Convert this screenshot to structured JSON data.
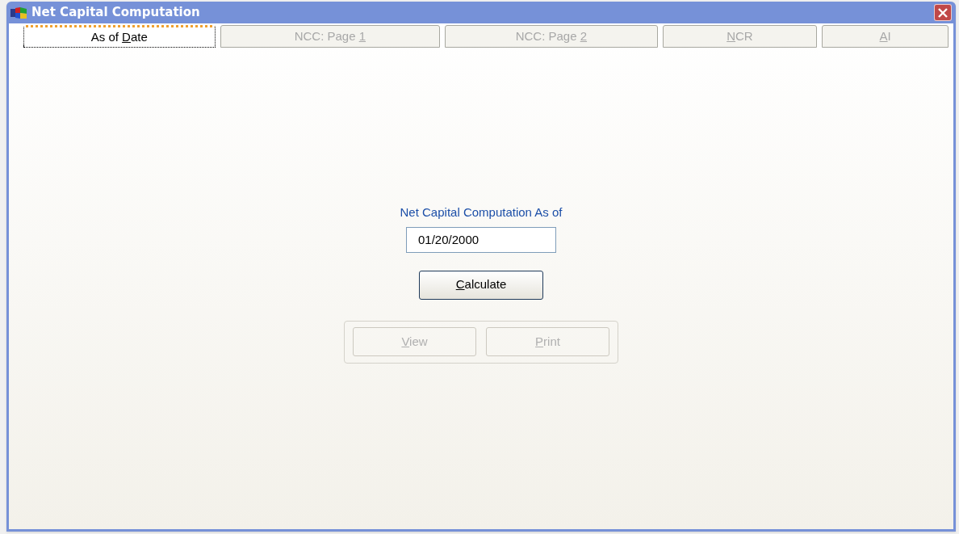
{
  "window": {
    "title": "Net Capital Computation"
  },
  "tabs": [
    {
      "before": "As of ",
      "mnemonic": "D",
      "after": "ate",
      "selected": true,
      "disabled": false
    },
    {
      "before": "NCC: Page ",
      "mnemonic": "1",
      "selected": false,
      "disabled": true
    },
    {
      "before": "NCC: Page ",
      "mnemonic": "2",
      "selected": false,
      "disabled": true
    },
    {
      "mnemonic": "N",
      "after": "CR",
      "selected": false,
      "disabled": true
    },
    {
      "mnemonic": "A",
      "after": "I",
      "selected": false,
      "disabled": true
    }
  ],
  "form": {
    "label": "Net Capital Computation As of",
    "date_value": "01/20/2000",
    "calculate": {
      "mnemonic": "C",
      "after": "alculate",
      "disabled": false
    },
    "buttons": [
      {
        "mnemonic": "V",
        "after": "iew",
        "disabled": true
      },
      {
        "mnemonic": "P",
        "after": "rint",
        "disabled": true
      }
    ]
  }
}
